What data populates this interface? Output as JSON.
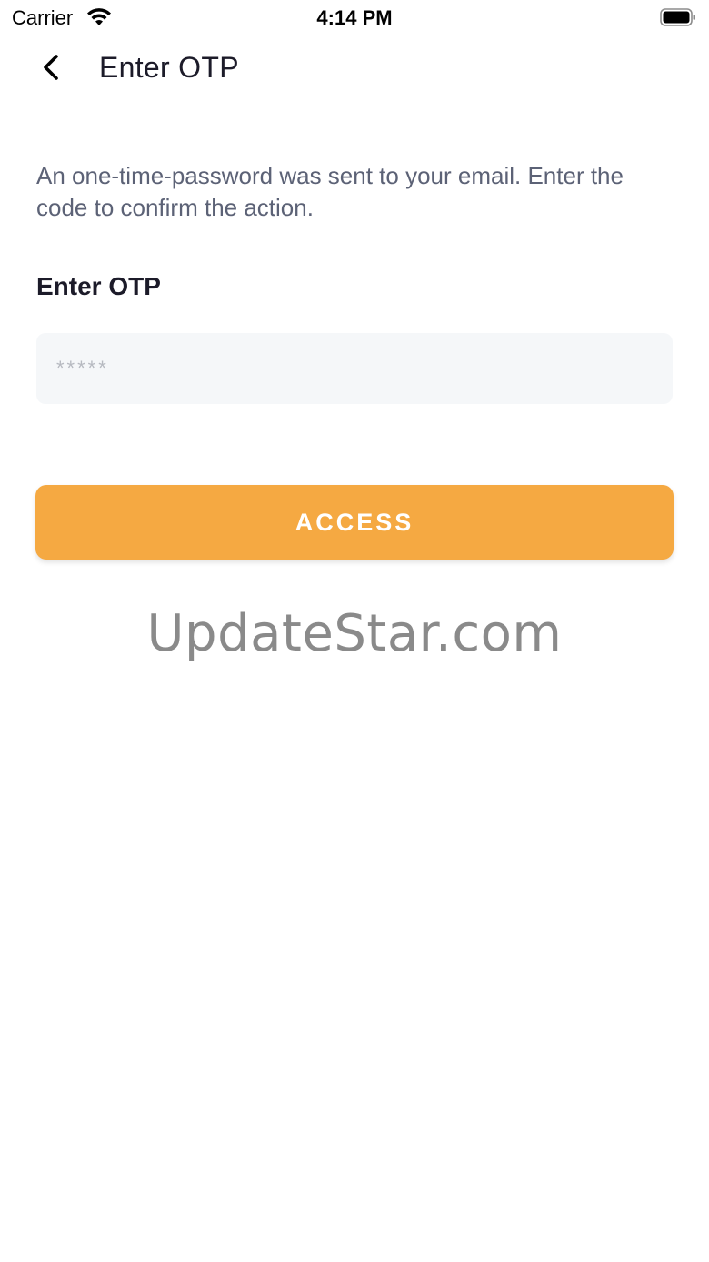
{
  "status_bar": {
    "carrier": "Carrier",
    "time": "4:14 PM",
    "wifi_icon": "wifi-icon",
    "battery_icon": "battery-icon"
  },
  "header": {
    "back_icon": "chevron-left-icon",
    "title": "Enter OTP"
  },
  "main": {
    "description": "An one-time-password was sent to your email. Enter the code to confirm the action.",
    "otp_field": {
      "label": "Enter OTP",
      "placeholder": "*****",
      "value": ""
    },
    "access_button_label": "ACCESS"
  },
  "watermark": "UpdateStar.com",
  "colors": {
    "accent": "#f5a942",
    "title_text": "#1c1b29",
    "body_text": "#5c6276",
    "input_background": "#f5f7f9"
  }
}
